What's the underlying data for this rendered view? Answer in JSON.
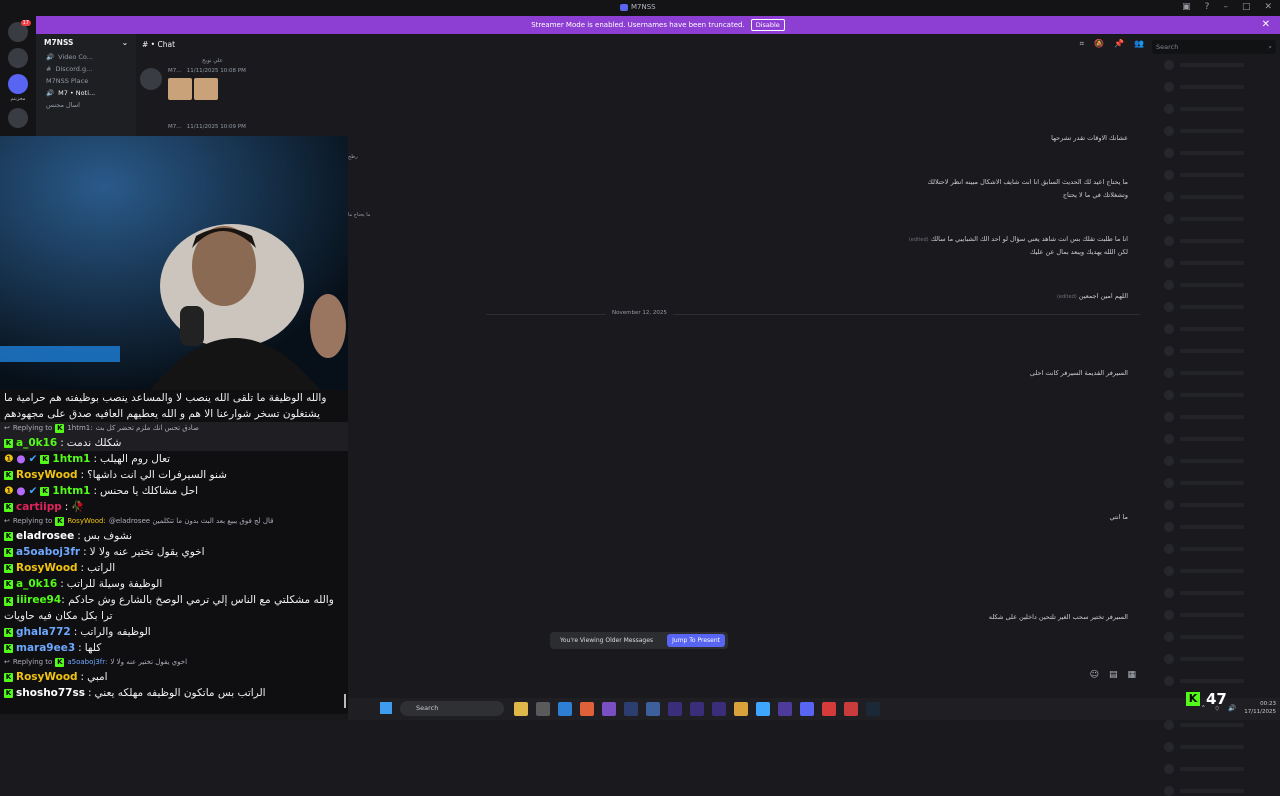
{
  "window": {
    "title": "M7NSS"
  },
  "banner": {
    "text": "Streamer Mode is enabled. Usernames have been truncated.",
    "disable": "Disable"
  },
  "servers": [
    {
      "badge": "17"
    },
    {
      "badge": ""
    },
    {
      "badge": ""
    },
    {
      "label": "مخزنتم"
    },
    {
      "badge": ""
    }
  ],
  "channels": {
    "server_name": "M7NSS",
    "items": [
      "Video Co...",
      "Discord.g...",
      "M7NSS Place",
      "M7 • Noti...",
      "اسال مجنس"
    ]
  },
  "chat_header": {
    "title": "Chat"
  },
  "search": {
    "placeholder": "Search"
  },
  "messages": {
    "top_label": "علي نوبح",
    "meta1": {
      "name": "M7...",
      "time": "11/11/2025 10:08 PM"
    },
    "meta2": {
      "name": "M7...",
      "time": "11/11/2025 10:09 PM"
    },
    "left_snips": [
      "رطح",
      "ما يحتاج ما"
    ],
    "right_texts": [
      "عشانك الاوقات تقدر تشرحها",
      "ما يحتاج اعيد لك الحديث السابق انا انت شايف الاشكال مبينه انظر لاحتلالك",
      "وتشغلاتك في ما لا يحتاج",
      "انا ما طلبت تقلك بس انت شاهد يعني سؤال لو احد الك الشبايبي ما سالك",
      "لكن اللله يهديك ويبعد بمال عن عليك",
      "اللهم امين اجمعين",
      "السيرفر القديمة السيرفر كانت احلى",
      "ما انتي",
      "السيرفر تختير سحب الغير تلتحين داخلين على شكله"
    ],
    "edited": "(edited)",
    "date_divider": "November 12, 2025"
  },
  "older_bar": {
    "text": "You're Viewing Older Messages",
    "jump": "Jump To Present"
  },
  "stream_chat": [
    {
      "type": "multi",
      "text": "والله الوظيفة ما تلقى الله ينصب لا والمساعد ينصب بوظيفته هم حرامية ما يشتغلون تسخر شوارعنا الا هم و الله يعطيهم العافيه صدق على مجهودهم"
    },
    {
      "type": "reply",
      "to": "1htm1:",
      "text": "صادق تحس انك ملزم تحضر كل بث",
      "prefix": "Replying to"
    },
    {
      "type": "msg",
      "user": "a_0k16",
      "color": "#53fc18",
      "text": "شكلك ندمت"
    },
    {
      "type": "msg",
      "user": "1htm1",
      "color": "#53fc18",
      "badges": true,
      "text": "تعال روم الهيلب"
    },
    {
      "type": "msg",
      "user": "RosyWood",
      "color": "#f1c40f",
      "text": "شنو السيرفرات الي انت داشها؟"
    },
    {
      "type": "msg",
      "user": "1htm1",
      "color": "#53fc18",
      "badges": true,
      "text": "احل مشاكلك يا محنس"
    },
    {
      "type": "msg",
      "user": "cartiipp",
      "color": "#e0245e",
      "text": "🥀"
    },
    {
      "type": "reply",
      "to": "RosyWood:",
      "text": "@eladrosee قال لج فوق يبيع بعد البث بدون ما تتكلمين",
      "prefix": "Replying to"
    },
    {
      "type": "msg",
      "user": "eladrosee",
      "color": "#ffffff",
      "text": "نشوف بس"
    },
    {
      "type": "msg",
      "user": "a5oaboj3fr",
      "color": "#6ea8fe",
      "text": "اخوي يقول تختير عنه ولا لا"
    },
    {
      "type": "msg",
      "user": "RosyWood",
      "color": "#f1c40f",
      "text": "الراتب"
    },
    {
      "type": "msg",
      "user": "a_0k16",
      "color": "#53fc18",
      "text": "الوظيفة وسيلة للراتب"
    },
    {
      "type": "multi2",
      "user": "iiiree94",
      "color": "#53fc18",
      "text": "والله مشكلتي مع الناس إلي ترمي الوصخ بالشارع وش حادكم ترا بكل مكان فيه حاويات"
    },
    {
      "type": "msg",
      "user": "ghala772",
      "color": "#6ea8fe",
      "text": "الوظيفه والراتب"
    },
    {
      "type": "msg",
      "user": "mara9ee3",
      "color": "#6ea8fe",
      "text": "كلها"
    },
    {
      "type": "reply",
      "to": "a5oaboj3fr:",
      "text": "اخوي يقول تختير عنه ولا لا",
      "prefix": "Replying to"
    },
    {
      "type": "msg",
      "user": "RosyWood",
      "color": "#f1c40f",
      "text": "امبي"
    },
    {
      "type": "msg",
      "user": "shosho77ss",
      "color": "#ffffff",
      "text": "الراتب بس ماتكون الوظيفه مهلكه يعني"
    }
  ],
  "taskbar": {
    "search": "Search",
    "time": "00:23",
    "date": "17/11/2025"
  },
  "kick_viewers": "47",
  "colors": {
    "banner": "#8d3fd3",
    "accent": "#5865f2",
    "kick": "#53fc18"
  }
}
